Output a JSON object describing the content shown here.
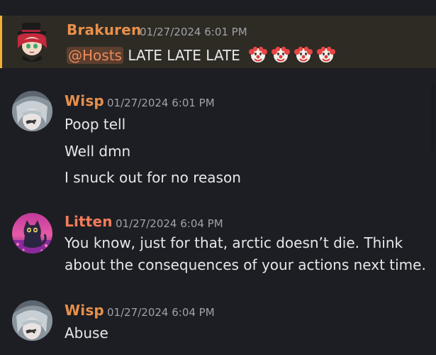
{
  "messages": [
    {
      "author": "Brakuren",
      "timestamp": "01/27/2024 6:01 PM",
      "mention": "@Hosts",
      "text": "LATE LATE LATE",
      "emojis": [
        "clown-face",
        "clown-face",
        "clown-face",
        "clown-face"
      ],
      "author_color": "#e8904a"
    },
    {
      "author": "Wisp",
      "timestamp": "01/27/2024 6:01 PM",
      "lines": [
        "Poop tell",
        "Well dmn",
        "I snuck out for no reason"
      ],
      "author_color": "#e8904a"
    },
    {
      "author": "Litten",
      "timestamp": "01/27/2024 6:04 PM",
      "lines": [
        "You know, just for that, arctic doesn’t die. Think",
        "about the consequences of your actions next time."
      ],
      "author_color": "#f27c5a"
    },
    {
      "author": "Wisp",
      "timestamp": "01/27/2024 6:04 PM",
      "lines": [
        "Abuse"
      ],
      "author_color": "#e8904a"
    }
  ]
}
